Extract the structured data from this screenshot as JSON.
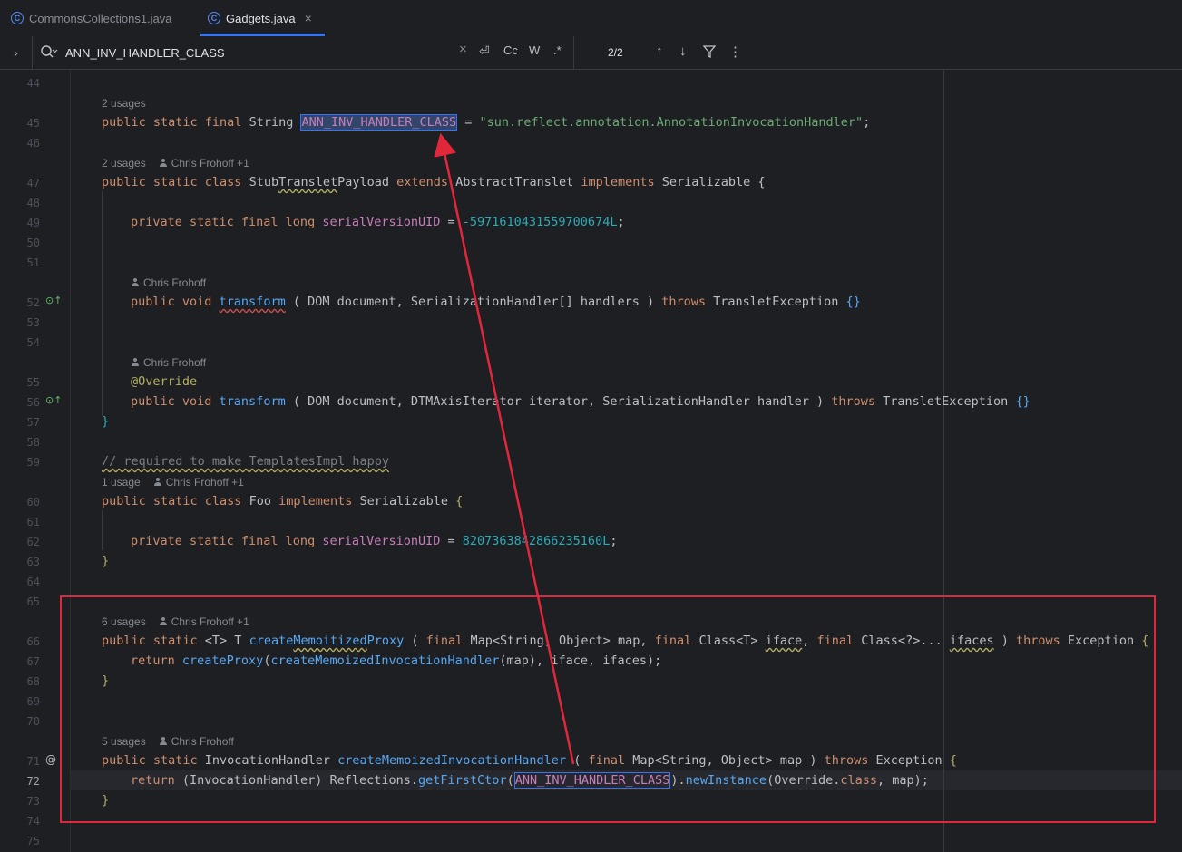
{
  "tabs": [
    {
      "label": "CommonsCollections1.java",
      "icon": "class-icon"
    },
    {
      "label": "Gadgets.java",
      "icon": "class-icon",
      "close": "×"
    }
  ],
  "search": {
    "expand": "›",
    "query": "ANN_INV_HANDLER_CLASS",
    "clear": "×",
    "regex_newline": "⏎",
    "match_case": "Cc",
    "words": "W",
    "regex": ".*",
    "count": "2/2",
    "prev": "↑",
    "next": "↓",
    "filter": "⏃",
    "more": "⋮"
  },
  "hints": {
    "h45": "2 usages",
    "h47a": "2 usages",
    "h47b": "Chris Frohoff +1",
    "h52": "Chris Frohoff",
    "h55": "Chris Frohoff",
    "h60a": "1 usage",
    "h60b": "Chris Frohoff +1",
    "h66a": "6 usages",
    "h66b": "Chris Frohoff +1",
    "h71a": "5 usages",
    "h71b": "Chris Frohoff"
  },
  "lines": [
    "44",
    "45",
    "46",
    "47",
    "48",
    "49",
    "50",
    "51",
    "52",
    "53",
    "54",
    "55",
    "56",
    "57",
    "58",
    "59",
    "60",
    "61",
    "62",
    "63",
    "64",
    "65",
    "66",
    "67",
    "68",
    "69",
    "70",
    "71",
    "72",
    "73",
    "74",
    "75"
  ],
  "code": {
    "l45": {
      "kw": "public static final ",
      "type": "String ",
      "name": "ANN_INV_HANDLER_CLASS",
      "eq": " = ",
      "str": "\"sun.reflect.annotation.AnnotationInvocationHandler\"",
      "end": ";"
    },
    "l47": {
      "kw": "public static class ",
      "n1": "Stub",
      "n2": "Translet",
      "n3": "Payload ",
      "kw2": "extends ",
      "t1": "AbstractTranslet ",
      "kw3": "implements ",
      "t2": "Serializable ",
      "br": "{"
    },
    "l49": {
      "kw": "private static final long ",
      "f": "serialVersionUID",
      "eq": " = ",
      "num": "-5971610431559700674L",
      "end": ";"
    },
    "l52": {
      "kw": "public void ",
      "m": "transform",
      "p1": " ( ",
      "t1": "DOM ",
      "v1": "document",
      "c": ", ",
      "t2": "SerializationHandler[] ",
      "v2": "handlers",
      "p2": " ) ",
      "kw2": "throws ",
      "t3": "TransletException ",
      "br": "{}"
    },
    "l55": {
      "an": "@Override"
    },
    "l56": {
      "kw": "public void ",
      "m": "transform",
      "p1": " ( ",
      "t1": "DOM ",
      "v1": "document",
      "c1": ", ",
      "t2": "DTMAxisIterator ",
      "v2": "iterator",
      "c2": ", ",
      "t3": "SerializationHandler ",
      "v3": "handler",
      "p2": " ) ",
      "kw2": "throws ",
      "t4": "TransletException ",
      "br": "{}"
    },
    "l57": {
      "br": "}"
    },
    "l59": {
      "cm": "// required to make TemplatesImpl happy"
    },
    "l60": {
      "kw": "public static class ",
      "n": "Foo ",
      "kw2": "implements ",
      "t": "Serializable ",
      "br": "{"
    },
    "l62": {
      "kw": "private static final long ",
      "f": "serialVersionUID",
      "eq": " = ",
      "num": "8207363842866235160L",
      "end": ";"
    },
    "l63": {
      "br": "}"
    },
    "l66": {
      "kw": "public static ",
      "g": "<T> T ",
      "m1": "create",
      "m2": "Memoitized",
      "m3": "Proxy",
      "p1": " ( ",
      "kw2": "final ",
      "t1": "Map<String, Object> ",
      "v1": "map",
      "c1": ", ",
      "kw3": "final ",
      "t2": "Class<T> ",
      "v2": "iface",
      "c2": ", ",
      "kw4": "final ",
      "t3": "Class<?>... ",
      "v3": "ifaces",
      "p2": " ) ",
      "kw5": "throws ",
      "t4": "Exception ",
      "br": "{"
    },
    "l67": {
      "kw": "return ",
      "m1": "createProxy",
      "p1": "(",
      "m2": "createMemoizedInvocationHandler",
      "p2": "(map), iface, ifaces);"
    },
    "l68": {
      "br": "}"
    },
    "l71": {
      "kw": "public static ",
      "t1": "InvocationHandler ",
      "m": "createMemoizedInvocationHandler",
      "p1": " ( ",
      "kw2": "final ",
      "t2": "Map<String, Object> ",
      "v": "map",
      "p2": " ) ",
      "kw3": "throws ",
      "t3": "Exception ",
      "br": "{"
    },
    "l72": {
      "kw": "return ",
      "p1": "(InvocationHandler) ",
      "c": "Reflections.",
      "m1": "getFirstCtor",
      "p2": "(",
      "h": "ANN_INV_HANDLER_CLASS",
      "p3": ").",
      "m2": "newInstance",
      "p4": "(Override.",
      "kw2": "class",
      "p5": ", map);"
    },
    "l73": {
      "br": "}"
    }
  },
  "colors": {
    "keyword": "#cf8e6d",
    "string": "#6aab73",
    "number": "#2aacb8",
    "method": "#56a8f5",
    "field": "#c77dbb",
    "annotation": "#b3ae60",
    "highlight_box": "#e0283a",
    "arrow": "#e0283a"
  }
}
